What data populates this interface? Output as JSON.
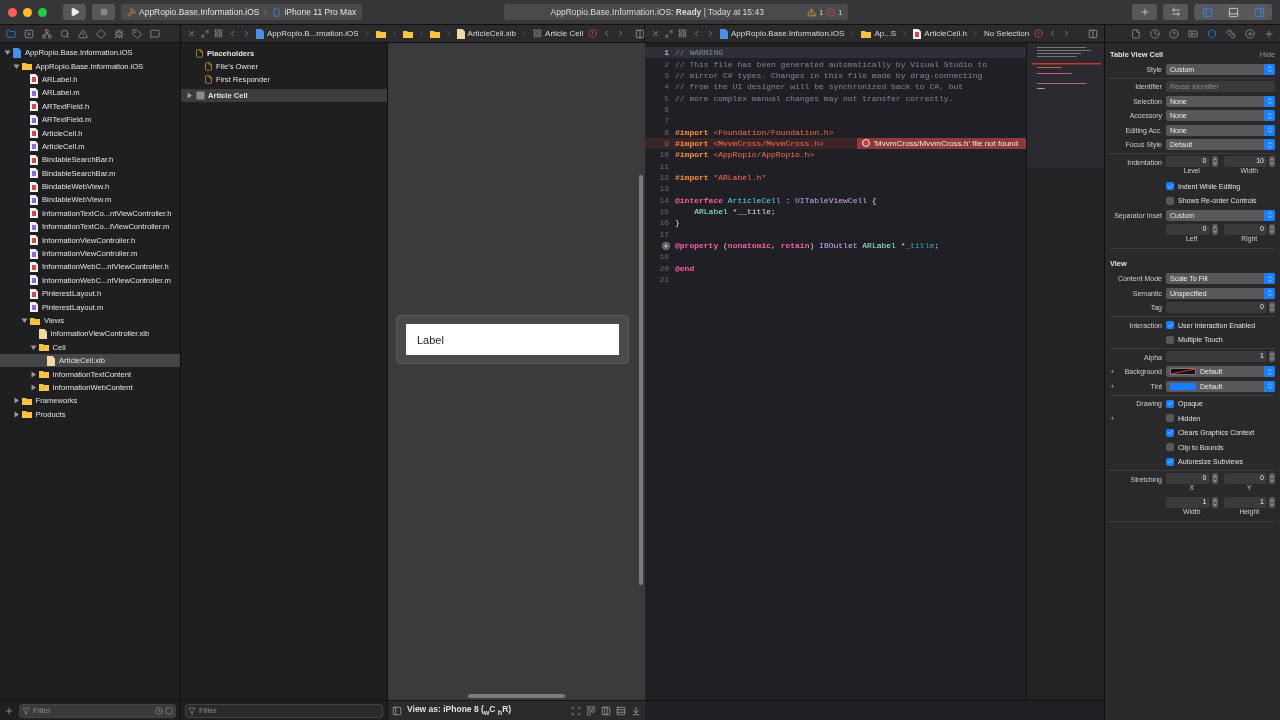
{
  "toolbar": {
    "scheme": "AppRopio.Base.Information.iOS",
    "device": "iPhone 11 Pro Max",
    "activity": "AppRopio.Base.Information.iOS: **Ready** | Today at 15:43",
    "warnings": "1",
    "errors": "1",
    "panels": [
      {
        "selected": true
      },
      {
        "selected": false
      },
      {
        "selected": true
      }
    ]
  },
  "navigator": {
    "tabs": [
      {
        "selected": true
      },
      {
        "selected": false
      },
      {
        "selected": false
      },
      {
        "selected": false
      },
      {
        "selected": false
      },
      {
        "selected": false
      },
      {
        "selected": false
      },
      {
        "selected": false
      },
      {
        "selected": false
      }
    ],
    "tree": [
      {
        "name": "AppRopio.Base.Information.iOS",
        "kind": "project",
        "expanded": true,
        "selected": false,
        "children": [
          {
            "name": "AppRopio.Base.Information.iOS",
            "kind": "folder",
            "expanded": true,
            "selected": false,
            "children": [
              {
                "name": "ARLabel.h",
                "kind": "h",
                "selected": false
              },
              {
                "name": "ARLabel.m",
                "kind": "m",
                "selected": false
              },
              {
                "name": "ARTextField.h",
                "kind": "h",
                "selected": false
              },
              {
                "name": "ARTextField.m",
                "kind": "m",
                "selected": false
              },
              {
                "name": "ArticleCell.h",
                "kind": "h",
                "selected": false
              },
              {
                "name": "ArticleCell.m",
                "kind": "m",
                "selected": false
              },
              {
                "name": "BindableSearchBar.h",
                "kind": "h",
                "selected": false
              },
              {
                "name": "BindableSearchBar.m",
                "kind": "m",
                "selected": false
              },
              {
                "name": "BindableWebView.h",
                "kind": "h",
                "selected": false
              },
              {
                "name": "BindableWebView.m",
                "kind": "m",
                "selected": false
              },
              {
                "name": "InformationTextCo...ntViewController.h",
                "kind": "h",
                "selected": false
              },
              {
                "name": "InformationTextCo...tViewController.m",
                "kind": "m",
                "selected": false
              },
              {
                "name": "InformationViewController.h",
                "kind": "h",
                "selected": false
              },
              {
                "name": "InformationViewController.m",
                "kind": "m",
                "selected": false
              },
              {
                "name": "InformationWebC...ntViewController.h",
                "kind": "h",
                "selected": false
              },
              {
                "name": "InformationWebC...ntViewController.m",
                "kind": "m",
                "selected": false
              },
              {
                "name": "PinterestLayout.h",
                "kind": "h",
                "selected": false
              },
              {
                "name": "PinterestLayout.m",
                "kind": "m",
                "selected": false
              },
              {
                "name": "Views",
                "kind": "folder",
                "expanded": true,
                "selected": false,
                "children": [
                  {
                    "name": "InformationViewController.xib",
                    "kind": "xib",
                    "selected": false
                  },
                  {
                    "name": "Cell",
                    "kind": "folder",
                    "expanded": true,
                    "selected": false,
                    "children": [
                      {
                        "name": "ArticleCell.xib",
                        "kind": "xib",
                        "selected": true
                      }
                    ]
                  },
                  {
                    "name": "InformationTextContent",
                    "kind": "folder",
                    "expanded": false,
                    "selected": false
                  },
                  {
                    "name": "InformationWebContent",
                    "kind": "folder",
                    "expanded": false,
                    "selected": false
                  }
                ]
              }
            ]
          },
          {
            "name": "Frameworks",
            "kind": "folder",
            "expanded": false,
            "selected": false
          },
          {
            "name": "Products",
            "kind": "folder",
            "expanded": false,
            "selected": false
          }
        ]
      }
    ],
    "filter": {
      "placeholder": "Filter"
    }
  },
  "interface_builder": {
    "jump_bar": [
      {
        "kind": "project",
        "text": "AppRopio.B...rmation.iOS"
      },
      {
        "kind": "folder"
      },
      {
        "kind": "folder"
      },
      {
        "kind": "folder"
      },
      {
        "kind": "xib",
        "text": "ArticleCell.xib"
      },
      {
        "kind": "view",
        "text": "Article Cell"
      }
    ],
    "outline": {
      "title": "Placeholders",
      "placeholders": [
        "File's Owner",
        "First Responder"
      ],
      "objects": [
        {
          "name": "Article Cell",
          "expanded": false,
          "selected": true
        }
      ]
    },
    "outline_filter": {
      "placeholder": "Filter"
    },
    "cell_label": "Label",
    "view_as": "View as: iPhone 8 ($_{w}$C $_{h}$R)"
  },
  "editor": {
    "jump_bar": [
      {
        "kind": "project",
        "text": "AppRopio.Base.Information.iOS"
      },
      {
        "kind": "folder",
        "text": "Ap...S"
      },
      {
        "kind": "header",
        "text": "ArticleCell.h"
      },
      {
        "kind": "none",
        "text": "No Selection"
      }
    ],
    "lines": [
      {
        "number": "1",
        "current": true,
        "tokens": [
          {
            "kind": "comment",
            "text": "// WARNING"
          }
        ]
      },
      {
        "number": "2",
        "tokens": [
          {
            "kind": "comment",
            "text": "// This file has been generated automatically by Visual Studio to"
          }
        ]
      },
      {
        "number": "3",
        "tokens": [
          {
            "kind": "comment",
            "text": "// mirror C# types. Changes in this file made by drag-connecting"
          }
        ]
      },
      {
        "number": "4",
        "tokens": [
          {
            "kind": "comment",
            "text": "// from the UI designer will be synchronized back to C#, but"
          }
        ]
      },
      {
        "number": "5",
        "tokens": [
          {
            "kind": "comment",
            "text": "// more complex manual changes may not transfer correctly."
          }
        ]
      },
      {
        "number": "6"
      },
      {
        "number": "7"
      },
      {
        "number": "8",
        "tokens": [
          {
            "kind": "preproc",
            "text": "#import "
          },
          {
            "kind": "string",
            "text": "<Foundation/Foundation.h>"
          }
        ]
      },
      {
        "number": "9",
        "error": "'MvvmCross/MvvmCross.h' file not found",
        "tokens": [
          {
            "kind": "preproc",
            "text": "#import "
          },
          {
            "kind": "string",
            "text": "<MvvmCross/MvvmCross.h>"
          }
        ]
      },
      {
        "number": "10",
        "tokens": [
          {
            "kind": "preproc",
            "text": "#import "
          },
          {
            "kind": "string",
            "text": "<AppRopio/AppRopio.h>"
          }
        ]
      },
      {
        "number": "11"
      },
      {
        "number": "12",
        "tokens": [
          {
            "kind": "preproc",
            "text": "#import "
          },
          {
            "kind": "string",
            "text": "\"ARLabel.h\""
          }
        ]
      },
      {
        "number": "13"
      },
      {
        "number": "14",
        "tokens": [
          {
            "kind": "keyword",
            "text": "@interface "
          },
          {
            "kind": "decl",
            "text": "ArticleCell"
          },
          {
            "kind": "plain",
            "text": " : "
          },
          {
            "kind": "type",
            "text": "UITableViewCell"
          },
          {
            "kind": "plain",
            "text": " {"
          }
        ]
      },
      {
        "number": "15",
        "tokens": [
          {
            "kind": "project",
            "text": "    ARLabel"
          },
          {
            "kind": "plain",
            "text": " *__title;"
          }
        ]
      },
      {
        "number": "16",
        "tokens": [
          {
            "kind": "plain",
            "text": "}"
          }
        ]
      },
      {
        "number": "17"
      },
      {
        "outlet": true,
        "tokens": [
          {
            "kind": "keyword",
            "text": "@property"
          },
          {
            "kind": "plain",
            "text": " ("
          },
          {
            "kind": "keyword",
            "text": "nonatomic"
          },
          {
            "kind": "plain",
            "text": ", "
          },
          {
            "kind": "keyword",
            "text": "retain"
          },
          {
            "kind": "plain",
            "text": ") "
          },
          {
            "kind": "type",
            "text": "IBOutlet "
          },
          {
            "kind": "project",
            "text": "ARLabel"
          },
          {
            "kind": "plain",
            "text": " *"
          },
          {
            "kind": "ident",
            "text": "_title"
          },
          {
            "kind": "plain",
            "text": ";"
          }
        ]
      },
      {
        "number": "19"
      },
      {
        "number": "20",
        "tokens": [
          {
            "kind": "keyword",
            "text": "@end"
          }
        ]
      },
      {
        "number": "21"
      }
    ]
  },
  "inspector": {
    "tabs": [
      {
        "selected": false
      },
      {
        "selected": false
      },
      {
        "selected": false
      },
      {
        "selected": false
      },
      {
        "selected": true
      },
      {
        "selected": false
      },
      {
        "selected": false
      },
      {
        "selected": false
      }
    ],
    "sections": [
      {
        "title": "Table View Cell",
        "action": "Hide",
        "groups": [
          [
            {
              "kind": "select",
              "label": "Style",
              "value": "Custom"
            }
          ],
          [
            {
              "kind": "input",
              "label": "Identifier",
              "placeholder": "Reuse Identifier"
            },
            {
              "kind": "select",
              "label": "Selection",
              "value": "None"
            },
            {
              "kind": "select",
              "label": "Accessory",
              "value": "None"
            },
            {
              "kind": "select",
              "label": "Editing Acc.",
              "value": "None"
            },
            {
              "kind": "select",
              "label": "Focus Style",
              "value": "Default"
            }
          ],
          [
            {
              "kind": "steppers",
              "label": "Indentation",
              "fields": [
                {
                  "value": "0",
                  "caption": "Level"
                },
                {
                  "value": "10",
                  "caption": "Width"
                }
              ]
            },
            {
              "kind": "check",
              "text": "Indent While Editing",
              "checked": true
            },
            {
              "kind": "check",
              "text": "Shows Re-order Controls",
              "checked": false
            },
            {
              "kind": "select",
              "label": "Separator Inset",
              "value": "Custom"
            },
            {
              "kind": "steppers",
              "fields": [
                {
                  "value": "0",
                  "caption": "Left"
                },
                {
                  "value": "0",
                  "caption": "Right"
                }
              ]
            }
          ]
        ]
      },
      {
        "title": "View",
        "groups": [
          [
            {
              "kind": "select",
              "label": "Content Mode",
              "value": "Scale To Fill"
            },
            {
              "kind": "select",
              "label": "Semantic",
              "value": "Unspecified"
            },
            {
              "kind": "steppers",
              "label": "Tag",
              "fields": [
                {
                  "value": "0"
                }
              ]
            }
          ],
          [
            {
              "kind": "check",
              "label": "Interaction",
              "text": "User Interaction Enabled",
              "checked": true
            },
            {
              "kind": "check",
              "text": "Multiple Touch",
              "checked": false
            }
          ],
          [
            {
              "kind": "steppers",
              "label": "Alpha",
              "fields": [
                {
                  "value": "1"
                }
              ]
            },
            {
              "kind": "color",
              "label": "Background",
              "value": "Default",
              "plus": "+"
            },
            {
              "kind": "color",
              "label": "Tint",
              "value": "Default",
              "plus": "+",
              "color": "#1a7fff"
            }
          ],
          [
            {
              "kind": "check",
              "label": "Drawing",
              "text": "Opaque",
              "checked": true
            },
            {
              "kind": "check",
              "text": "Hidden",
              "checked": false,
              "plus": "+"
            },
            {
              "kind": "check",
              "text": "Clears Graphics Context",
              "checked": true
            },
            {
              "kind": "check",
              "text": "Clip to Bounds",
              "checked": false
            },
            {
              "kind": "check",
              "text": "Autoresize Subviews",
              "checked": true
            }
          ],
          [
            {
              "kind": "steppers",
              "label": "Stretching",
              "fields": [
                {
                  "value": "0",
                  "caption": "X"
                },
                {
                  "value": "0",
                  "caption": "Y"
                }
              ]
            },
            {
              "kind": "steppers",
              "fields": [
                {
                  "value": "1",
                  "caption": "Width"
                },
                {
                  "value": "1",
                  "caption": "Height"
                }
              ]
            }
          ]
        ]
      }
    ]
  }
}
